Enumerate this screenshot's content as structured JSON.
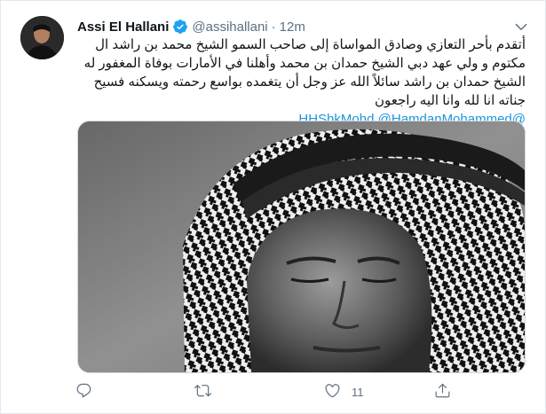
{
  "tweet": {
    "author_name": "Assi El Hallani",
    "handle": "@assihallani",
    "separator": "·",
    "time": "12m",
    "text_lines": [
      "أتقدم بأحر التعازي وصادق المواساة إلى  صاحب السمو الشيخ محمد بن راشد ال",
      "مكتوم و ولي عهد دبي الشيخ حمدان بن محمد وأهلنا في الأمارات بوفاة المغفور له",
      "الشيخ حمدان بن راشد سائلاً الله عز وجل أن يتغمده بواسع رحمته ويسكنه فسيح",
      "جناته انا لله وانا اليه راجعون"
    ],
    "mentions": [
      "@HHShkMohd",
      "@HamdanMohammed"
    ],
    "like_count": "11"
  },
  "icons": {
    "verified": "verified-badge-icon",
    "caret": "chevron-down-icon",
    "reply": "reply-icon",
    "retweet": "retweet-icon",
    "like": "heart-icon",
    "share": "share-icon"
  },
  "colors": {
    "accent": "#1da1f2",
    "link": "#1b95e0",
    "muted": "#5b7083"
  }
}
